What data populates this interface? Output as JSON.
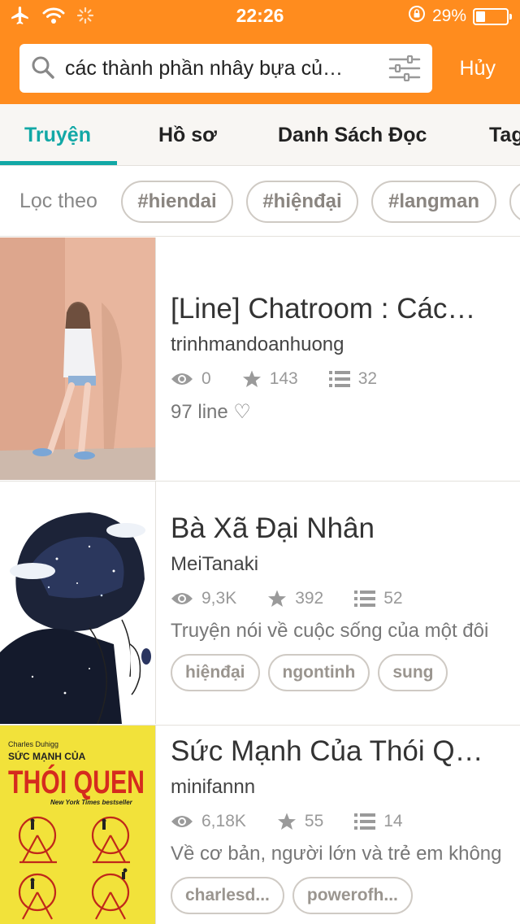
{
  "status_bar": {
    "time": "22:26",
    "battery_text": "29%",
    "icons": [
      "airplane-icon",
      "wifi-icon",
      "activity-spinner-icon",
      "rotation-lock-icon",
      "battery-icon"
    ]
  },
  "search": {
    "query": "các thành phần nhây bựa củ…",
    "cancel_label": "Hủy"
  },
  "tabs": [
    {
      "label": "Truyện",
      "active": true
    },
    {
      "label": "Hồ sơ",
      "active": false
    },
    {
      "label": "Danh Sách Đọc",
      "active": false
    },
    {
      "label": "Tag",
      "active": false
    }
  ],
  "filter": {
    "label": "Lọc theo",
    "chips": [
      "#hiendai",
      "#hiệnđại",
      "#langman"
    ]
  },
  "stories": [
    {
      "title": "[Line] Chatroom : Các…",
      "author": "trinhmandoanhuong",
      "views": "0",
      "votes": "143",
      "parts": "32",
      "description": "97 line ♡",
      "tags": []
    },
    {
      "title": "Bà Xã Đại Nhân",
      "author": "MeiTanaki",
      "views": "9,3K",
      "votes": "392",
      "parts": "52",
      "description": "Truyện nói về cuộc sống của một đôi",
      "tags": [
        "hiệnđại",
        "ngontinh",
        "sung"
      ]
    },
    {
      "title": "Sức Mạnh Của Thói Qu…",
      "author": "minifannn",
      "views": "6,18K",
      "votes": "55",
      "parts": "14",
      "description": "Về cơ bản, người lớn và trẻ em không",
      "tags": [
        "charlesd...",
        "powerofh..."
      ],
      "cover": {
        "author": "Charles Duhigg",
        "title_line1": "SỨC MẠNH CỦA",
        "title_line2": "THÓI QUEN",
        "subtitle": "New York Times bestseller"
      }
    }
  ],
  "colors": {
    "brand_orange": "#ff8c1e",
    "accent_teal": "#12a8a6",
    "cover_yellow": "#f2e23a",
    "cover_red": "#d52b1e"
  }
}
